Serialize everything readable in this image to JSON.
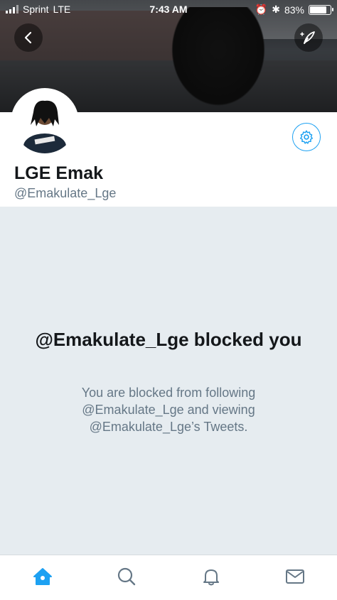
{
  "status_bar": {
    "carrier": "Sprint",
    "network": "LTE",
    "time": "7:43 AM",
    "battery": "83%",
    "battery_level": 0.83
  },
  "profile": {
    "name": "LGE Emak",
    "handle": "@Emakulate_Lge"
  },
  "blocked": {
    "title": "@Emakulate_Lge blocked you",
    "description": "You are blocked from following @Emakulate_Lge and viewing @Emakulate_Lge’s Tweets."
  },
  "icons": {
    "back": "back-arrow-icon",
    "compose": "compose-tweet-icon",
    "settings": "gear-icon",
    "home": "home-icon",
    "search": "search-icon",
    "notifications": "bell-icon",
    "messages": "envelope-icon"
  },
  "colors": {
    "accent": "#1da1f2",
    "blocked_bg": "#e6ecf0",
    "muted_text": "#657786",
    "primary_text": "#14171a"
  }
}
